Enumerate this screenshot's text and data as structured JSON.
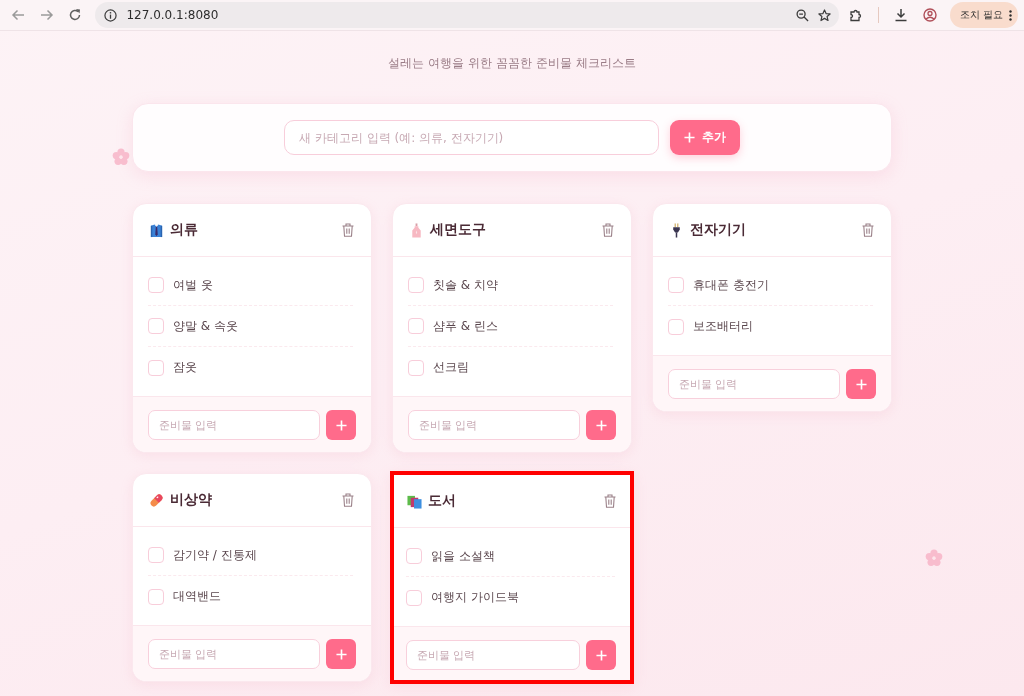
{
  "browser": {
    "url": "127.0.0.1:8080",
    "action_button": "조치 필요"
  },
  "subtitle": "설레는 여행을 위한 꼼꼼한 준비물 체크리스트",
  "new_category": {
    "placeholder": "새 카테고리 입력 (예: 의류, 전자기기)",
    "button": "추가"
  },
  "categories": [
    {
      "title": "의류",
      "highlighted": false,
      "items": [
        {
          "label": "여벌 옷",
          "checked": false
        },
        {
          "label": "양말 & 속옷",
          "checked": false
        },
        {
          "label": "잠옷",
          "checked": false
        }
      ],
      "input": {
        "placeholder": "준비물 입력"
      }
    },
    {
      "title": "세면도구",
      "highlighted": false,
      "items": [
        {
          "label": "칫솔 & 치약",
          "checked": false
        },
        {
          "label": "샴푸 & 린스",
          "checked": false
        },
        {
          "label": "선크림",
          "checked": false
        }
      ],
      "input": {
        "placeholder": "준비물 입력"
      }
    },
    {
      "title": "전자기기",
      "highlighted": false,
      "items": [
        {
          "label": "휴대폰 충전기",
          "checked": false
        },
        {
          "label": "보조배터리",
          "checked": false
        }
      ],
      "input": {
        "placeholder": "준비물 입력"
      }
    },
    {
      "title": "비상약",
      "highlighted": false,
      "items": [
        {
          "label": "감기약 / 진통제",
          "checked": false
        },
        {
          "label": "대역밴드",
          "checked": false
        }
      ],
      "input": {
        "placeholder": "준비물 입력"
      }
    },
    {
      "title": "도서",
      "highlighted": true,
      "items": [
        {
          "label": "읽을 소설책",
          "checked": false
        },
        {
          "label": "여행지 가이드북",
          "checked": false
        }
      ],
      "input": {
        "placeholder": "준비물 입력"
      }
    }
  ]
}
